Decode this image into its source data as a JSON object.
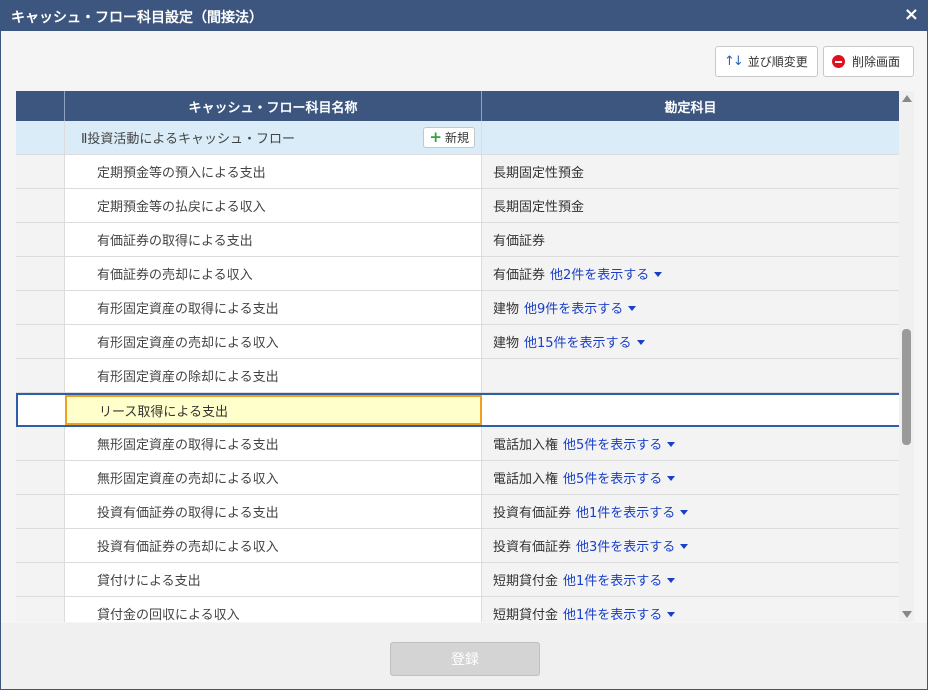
{
  "window": {
    "title": "キャッシュ・フロー科目設定（間接法）",
    "close": "×"
  },
  "toolbar": {
    "sort_label": "並び順変更",
    "delete_label": "削除画面"
  },
  "table": {
    "headers": [
      "",
      "キャッシュ・フロー科目名称",
      "勘定科目"
    ],
    "section": {
      "label": "Ⅱ投資活動によるキャッシュ・フロー",
      "new_label": "新規"
    },
    "rows": [
      {
        "name": "定期預金等の預入による支出",
        "account": "長期固定性預金",
        "more": ""
      },
      {
        "name": "定期預金等の払戻による収入",
        "account": "長期固定性預金",
        "more": ""
      },
      {
        "name": "有価証券の取得による支出",
        "account": "有価証券",
        "more": ""
      },
      {
        "name": "有価証券の売却による収入",
        "account": "有価証券",
        "more": "他2件を表示する"
      },
      {
        "name": "有形固定資産の取得による支出",
        "account": "建物",
        "more": "他9件を表示する"
      },
      {
        "name": "有形固定資産の売却による収入",
        "account": "建物",
        "more": "他15件を表示する"
      },
      {
        "name": "有形固定資産の除却による支出",
        "account": "",
        "more": ""
      }
    ],
    "editing_row": {
      "value": "リース取得による支出"
    },
    "rows_after": [
      {
        "name": "無形固定資産の取得による支出",
        "account": "電話加入権",
        "more": "他5件を表示する"
      },
      {
        "name": "無形固定資産の売却による収入",
        "account": "電話加入権",
        "more": "他5件を表示する"
      },
      {
        "name": "投資有価証券の取得による支出",
        "account": "投資有価証券",
        "more": "他1件を表示する"
      },
      {
        "name": "投資有価証券の売却による収入",
        "account": "投資有価証券",
        "more": "他3件を表示する"
      },
      {
        "name": "貸付けによる支出",
        "account": "短期貸付金",
        "more": "他1件を表示する"
      },
      {
        "name": "貸付金の回収による収入",
        "account": "短期貸付金",
        "more": "他1件を表示する"
      }
    ]
  },
  "footer": {
    "register_label": "登録"
  },
  "colors": {
    "header": "#3c5680",
    "link": "#1a3fc7",
    "section_bg": "#d9ecf7",
    "edit_bg": "#ffffcc",
    "edit_border": "#f0a020"
  }
}
